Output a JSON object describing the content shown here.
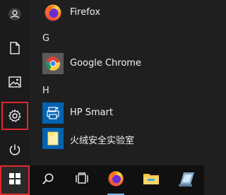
{
  "start_menu": {
    "groups": [
      {
        "items": [
          {
            "label": "Firefox",
            "icon": "firefox-icon"
          }
        ]
      },
      {
        "header": "G",
        "items": [
          {
            "label": "Google Chrome",
            "icon": "chrome-icon"
          }
        ]
      },
      {
        "header": "H",
        "items": [
          {
            "label": "HP Smart",
            "icon": "hp-smart-icon"
          },
          {
            "label": "火绒安全实验室",
            "icon": "folder-icon"
          }
        ]
      }
    ]
  },
  "rail": {
    "items": [
      "user-icon",
      "documents-icon",
      "pictures-icon",
      "settings-icon",
      "power-icon"
    ],
    "highlighted": "settings-icon"
  },
  "taskbar": {
    "items": [
      "start-button",
      "search-icon",
      "task-view-icon",
      "firefox-icon",
      "file-explorer-icon",
      "app-icon"
    ],
    "highlighted": "start-button"
  },
  "colors": {
    "highlight": "#e0282d",
    "tile_blue": "#0063b1",
    "tile_gray": "#5a5a5a"
  }
}
